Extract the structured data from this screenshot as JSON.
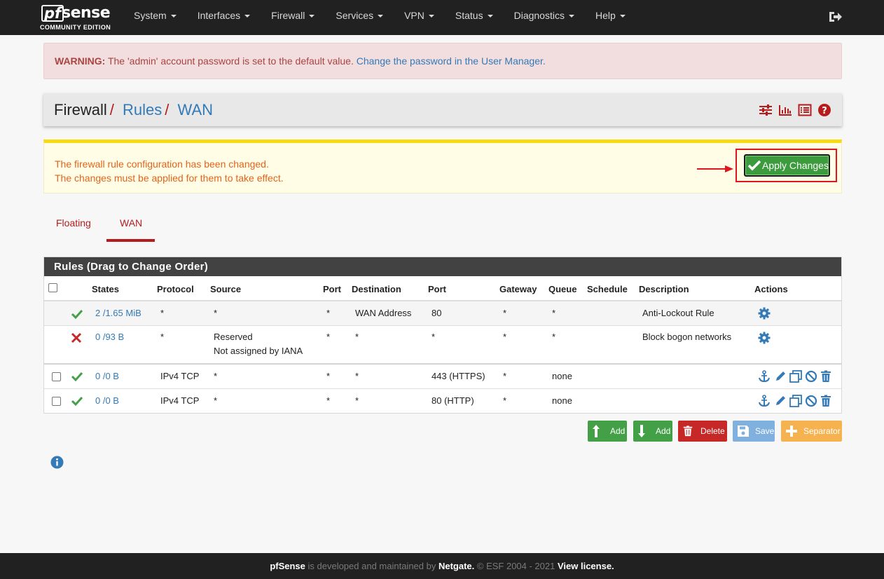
{
  "logo": {
    "pf": "pf",
    "sense": "sense",
    "edition": "COMMUNITY EDITION"
  },
  "nav": {
    "items": [
      {
        "label": "System"
      },
      {
        "label": "Interfaces"
      },
      {
        "label": "Firewall"
      },
      {
        "label": "Services"
      },
      {
        "label": "VPN"
      },
      {
        "label": "Status"
      },
      {
        "label": "Diagnostics"
      },
      {
        "label": "Help"
      }
    ]
  },
  "warning": {
    "strong": "WARNING:",
    "text": " The 'admin' account password is set to the default value. ",
    "link": "Change the password in the User Manager."
  },
  "breadcrumb": {
    "items": [
      "Firewall",
      "Rules",
      "WAN"
    ],
    "separator": "/"
  },
  "changed_alert": {
    "line1": "The firewall rule configuration has been changed.",
    "line2": "The changes must be applied for them to take effect.",
    "apply_label": "Apply Changes"
  },
  "tabs": {
    "floating": "Floating",
    "wan": "WAN"
  },
  "rules": {
    "title": "Rules (Drag to Change Order)",
    "headers": {
      "states": "States",
      "protocol": "Protocol",
      "source": "Source",
      "port": "Port",
      "destination": "Destination",
      "dport": "Port",
      "gateway": "Gateway",
      "queue": "Queue",
      "schedule": "Schedule",
      "description": "Description",
      "actions": "Actions"
    },
    "rows": [
      {
        "states": "2 /1.65 MiB",
        "protocol": "*",
        "source": "*",
        "source2": "",
        "port": "*",
        "destination": "WAN Address",
        "dport": "80",
        "gateway": "*",
        "queue": "*",
        "schedule": "",
        "description": "Anti-Lockout Rule"
      },
      {
        "states": "0 /93 B",
        "protocol": "*",
        "source": "Reserved",
        "source2": "Not assigned by IANA",
        "port": "*",
        "destination": "*",
        "dport": "*",
        "gateway": "*",
        "queue": "*",
        "schedule": "",
        "description": "Block bogon networks"
      },
      {
        "states": "0 /0 B",
        "protocol": "IPv4 TCP",
        "source": "*",
        "source2": "",
        "port": "*",
        "destination": "*",
        "dport": "443 (HTTPS)",
        "gateway": "*",
        "queue": "none",
        "schedule": "",
        "description": ""
      },
      {
        "states": "0 /0 B",
        "protocol": "IPv4 TCP",
        "source": "*",
        "source2": "",
        "port": "*",
        "destination": "*",
        "dport": "80 (HTTP)",
        "gateway": "*",
        "queue": "none",
        "schedule": "",
        "description": ""
      }
    ]
  },
  "buttons": {
    "add_top": "Add",
    "add_bottom": "Add",
    "delete": "Delete",
    "save": "Save",
    "separator": "Separator"
  },
  "footer": {
    "brand": "pfSense",
    "text1": " is developed and maintained by ",
    "netgate": "Netgate.",
    "text2": " © ESF 2004 - 2021 ",
    "license": "View license."
  },
  "colors": {
    "navbar": "#212121",
    "accent_red": "#b71c1c",
    "link_blue": "#337ab7",
    "pass_green": "#43a047",
    "block_red": "#c62828",
    "warning_orange": "#e5621b"
  }
}
